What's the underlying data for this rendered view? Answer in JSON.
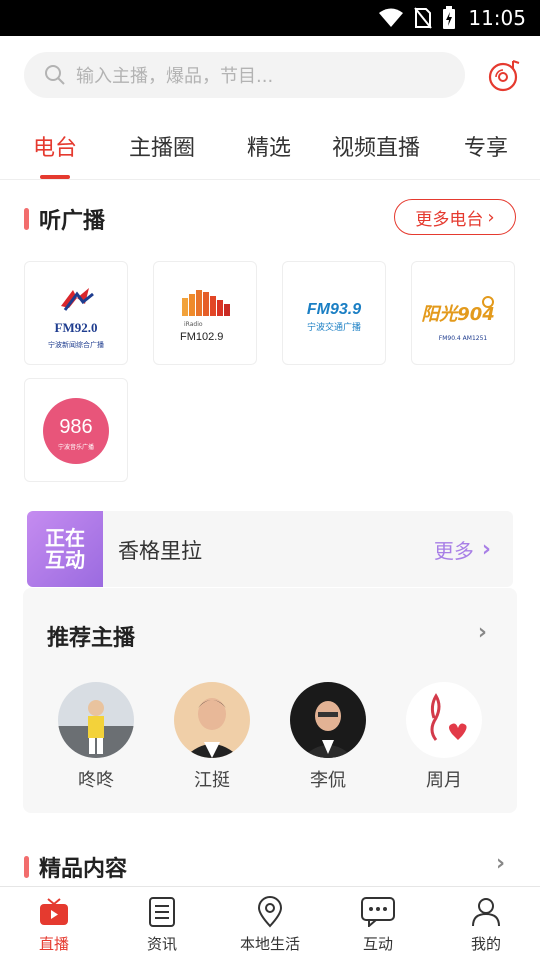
{
  "status_bar": {
    "time": "11:05"
  },
  "search": {
    "placeholder": "输入主播，爆品，节目..."
  },
  "tabs": [
    {
      "label": "电台",
      "active": true
    },
    {
      "label": "主播圈",
      "active": false
    },
    {
      "label": "精选",
      "active": false
    },
    {
      "label": "视频直播",
      "active": false
    },
    {
      "label": "专享",
      "active": false
    }
  ],
  "radio_section": {
    "title": "听广播",
    "more_label": "更多电台",
    "stations": [
      {
        "logo_text": "FM92.0",
        "sub_text": "宁波新闻综合广播"
      },
      {
        "logo_text": "FM102.9",
        "sub_text": "iRadio"
      },
      {
        "logo_text": "FM93.9",
        "sub_text": "宁波交通广播"
      },
      {
        "logo_text": "阳光904",
        "sub_text": "FM90.4 AM1251"
      },
      {
        "logo_text": "986",
        "sub_text": "宁波音乐广播"
      }
    ]
  },
  "live_strip": {
    "badge_line1": "正在",
    "badge_line2": "互动",
    "name": "香格里拉",
    "more_label": "更多"
  },
  "anchors_section": {
    "title": "推荐主播",
    "anchors": [
      {
        "name": "咚咚"
      },
      {
        "name": "江挺"
      },
      {
        "name": "李侃"
      },
      {
        "name": "周月"
      }
    ]
  },
  "featured_section": {
    "title": "精品内容"
  },
  "bottom_nav": [
    {
      "label": "直播",
      "icon": "tv-icon",
      "active": true
    },
    {
      "label": "资讯",
      "icon": "news-icon",
      "active": false
    },
    {
      "label": "本地生活",
      "icon": "location-icon",
      "active": false
    },
    {
      "label": "互动",
      "icon": "chat-icon",
      "active": false
    },
    {
      "label": "我的",
      "icon": "user-icon",
      "active": false
    }
  ],
  "colors": {
    "accent": "#e53a2f",
    "live_purple": "#a87fe6"
  }
}
